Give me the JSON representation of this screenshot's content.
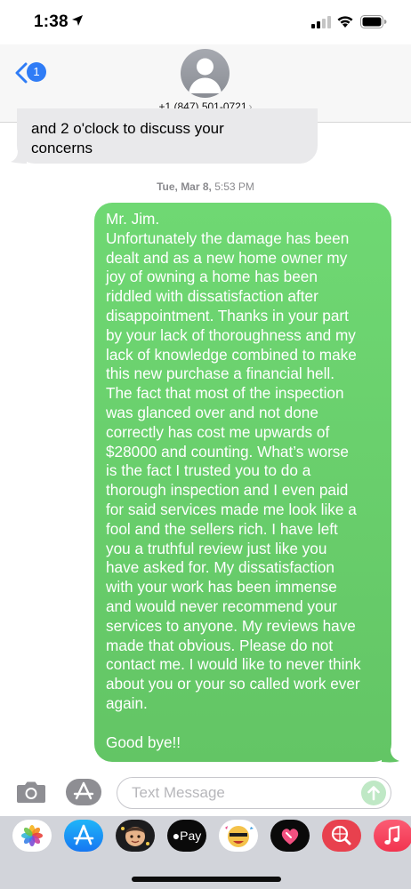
{
  "status_bar": {
    "time": "1:38"
  },
  "header": {
    "back_badge": "1",
    "contact_name": "+1 (847) 501-0721"
  },
  "messages": {
    "incoming": {
      "lines": [
        "and 2 o'clock to discuss your",
        "concerns"
      ]
    },
    "timestamp": {
      "date": "Tue, Mar 8,",
      "time": "5:53 PM"
    },
    "outgoing": {
      "lines": [
        "Mr. Jim.",
        "Unfortunately the damage has been",
        "dealt and as a new home owner my",
        "joy of owning a home has been",
        "riddled with dissatisfaction after",
        "disappointment. Thanks in your part",
        "by your lack of thoroughness and my",
        "lack of knowledge combined to make",
        "this new purchase a financial hell.",
        "The fact that most of the inspection",
        "was glanced over and not done",
        "correctly has cost me upwards of",
        "$28000 and counting. What’s worse",
        "is the fact I trusted you to do a",
        "thorough inspection and I even paid",
        "for said services made me look like a",
        "fool and the sellers rich. I have left",
        "you a truthful review just like you",
        "have asked for. My dissatisfaction",
        "with your work has been immense",
        "and would never recommend your",
        "services to anyone. My reviews have",
        "made that obvious. Please do not",
        "contact me. I would like to never think",
        "about you or your so called work ever",
        "again."
      ],
      "closing": "Good bye!!"
    }
  },
  "input": {
    "placeholder": "Text Message"
  },
  "app_drawer": {
    "apple_pay_label": "Pay",
    "icons": [
      "photos-icon",
      "app-store-icon",
      "memoji-icon",
      "apple-pay-icon",
      "animoji-icon",
      "digital-touch-icon",
      "web-search-icon",
      "music-icon"
    ]
  },
  "colors": {
    "outgoing_bubble": "#65c866",
    "incoming_bubble": "#e9e9eb",
    "accent_blue": "#2f7cf6"
  }
}
